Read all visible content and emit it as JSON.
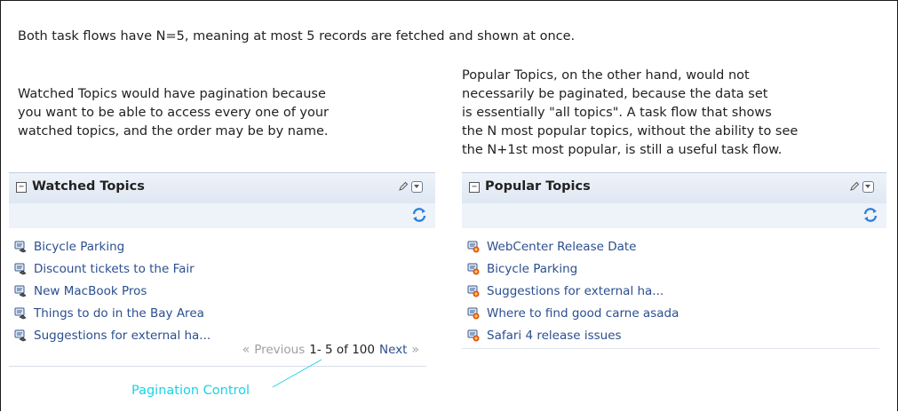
{
  "intro": "Both task flows have N=5, meaning at most 5 records are fetched and shown at once.",
  "left_paragraph": "Watched Topics would have pagination because\nyou want to be able to access every one of your\nwatched topics, and the order may be by name.",
  "right_paragraph": "Popular Topics, on the other hand, would not\nnecessarily be paginated, because the data set\nis essentially \"all topics\".  A task flow that shows\nthe N most popular topics, without the ability to see\nthe N+1st most popular, is still a useful task flow.",
  "watched": {
    "title": "Watched Topics",
    "collapse_glyph": "−",
    "items": [
      "Bicycle Parking",
      "Discount tickets to the Fair",
      "New MacBook Pros",
      "Things to do in the Bay Area",
      "Suggestions for external ha..."
    ]
  },
  "popular": {
    "title": "Popular Topics",
    "collapse_glyph": "−",
    "items": [
      "WebCenter Release Date",
      "Bicycle Parking",
      "Suggestions for external ha...",
      "Where to find good carne asada",
      "Safari 4 release issues"
    ]
  },
  "pager": {
    "prev_glyph": "«",
    "previous": "Previous",
    "range": "1- 5 of 100",
    "next": "Next",
    "next_glyph": "»"
  },
  "annotation": "Pagination Control",
  "colors": {
    "link": "#2b4f8f",
    "annotation": "#19d3e6",
    "header_bg": "#e6edf7"
  },
  "icons": [
    "collapse-icon",
    "pencil-icon",
    "menu-dropdown-icon",
    "refresh-icon",
    "watched-topic-icon",
    "popular-topic-icon"
  ]
}
